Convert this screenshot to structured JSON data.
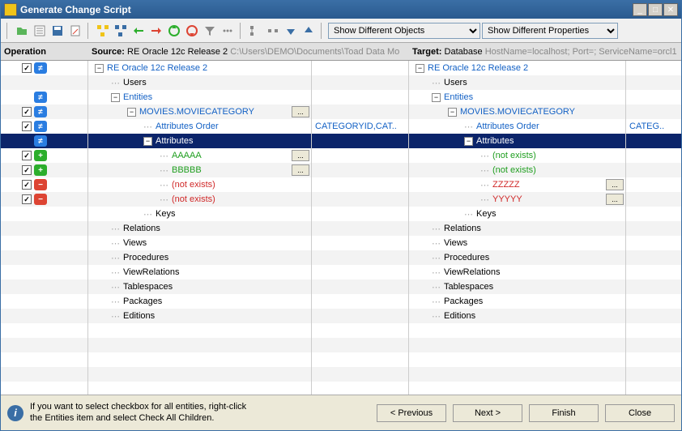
{
  "window": {
    "title": "Generate Change Script"
  },
  "toolbar": {
    "combo1": "Show Different Objects",
    "combo2": "Show Different Properties"
  },
  "headers": {
    "operation": "Operation",
    "source_label": "Source:",
    "source_model": "RE Oracle 12c Release 2",
    "source_path": "C:\\Users\\DEMO\\Documents\\Toad Data Mo",
    "target_label": "Target:",
    "target_model": "Database",
    "target_path": "HostName=localhost; Port=; ServiceName=orcl1"
  },
  "rows": [
    {
      "op": {
        "cb": true,
        "badge": "diff",
        "sym": "≠"
      },
      "src": {
        "indent": 0,
        "exp": "-",
        "text": "RE Oracle 12c Release 2",
        "cls": "blue"
      },
      "tgt": {
        "indent": 0,
        "exp": "-",
        "text": "RE Oracle 12c Release 2",
        "cls": "blue"
      }
    },
    {
      "op": {},
      "src": {
        "indent": 1,
        "bul": true,
        "text": "Users"
      },
      "tgt": {
        "indent": 1,
        "bul": true,
        "text": "Users"
      }
    },
    {
      "op": {
        "badge": "diff",
        "sym": "≠"
      },
      "src": {
        "indent": 1,
        "exp": "-",
        "text": "Entities",
        "cls": "blue"
      },
      "tgt": {
        "indent": 1,
        "exp": "-",
        "text": "Entities",
        "cls": "blue"
      }
    },
    {
      "op": {
        "cb": true,
        "badge": "diff",
        "sym": "≠"
      },
      "src": {
        "indent": 2,
        "exp": "-",
        "text": "MOVIES.MOVIECATEGORY",
        "cls": "blue",
        "more": true
      },
      "tgt": {
        "indent": 2,
        "exp": "-",
        "text": "MOVIES.MOVIECATEGORY",
        "cls": "blue"
      }
    },
    {
      "op": {
        "cb": true,
        "badge": "diff",
        "sym": "≠"
      },
      "src": {
        "indent": 3,
        "bul": true,
        "text": "Attributes Order",
        "cls": "blue"
      },
      "srcdet": "CATEGORYID,CAT..",
      "tgt": {
        "indent": 3,
        "bul": true,
        "text": "Attributes Order",
        "cls": "blue"
      },
      "tgtdet": "CATEG.."
    },
    {
      "sel": true,
      "op": {
        "badge": "diff",
        "sym": "≠"
      },
      "src": {
        "indent": 3,
        "exp": "-",
        "text": "Attributes"
      },
      "tgt": {
        "indent": 3,
        "exp": "-",
        "text": "Attributes"
      }
    },
    {
      "op": {
        "cb": true,
        "badge": "plus",
        "sym": "+"
      },
      "src": {
        "indent": 4,
        "bul": true,
        "text": "AAAAA",
        "cls": "green",
        "more": true
      },
      "tgt": {
        "indent": 4,
        "bul": true,
        "text": "(not exists)",
        "cls": "green"
      }
    },
    {
      "op": {
        "cb": true,
        "badge": "plus",
        "sym": "+"
      },
      "src": {
        "indent": 4,
        "bul": true,
        "text": "BBBBB",
        "cls": "green",
        "more": true
      },
      "tgt": {
        "indent": 4,
        "bul": true,
        "text": "(not exists)",
        "cls": "green"
      }
    },
    {
      "op": {
        "cb": true,
        "badge": "minus",
        "sym": "−"
      },
      "src": {
        "indent": 4,
        "bul": true,
        "text": "(not exists)",
        "cls": "red"
      },
      "tgt": {
        "indent": 4,
        "bul": true,
        "text": "ZZZZZ",
        "cls": "red",
        "more": true
      }
    },
    {
      "op": {
        "cb": true,
        "badge": "minus",
        "sym": "−"
      },
      "src": {
        "indent": 4,
        "bul": true,
        "text": "(not exists)",
        "cls": "red"
      },
      "tgt": {
        "indent": 4,
        "bul": true,
        "text": "YYYYY",
        "cls": "red",
        "more": true
      }
    },
    {
      "op": {},
      "src": {
        "indent": 3,
        "bul": true,
        "text": "Keys"
      },
      "tgt": {
        "indent": 3,
        "bul": true,
        "text": "Keys"
      }
    },
    {
      "op": {},
      "src": {
        "indent": 1,
        "bul": true,
        "text": "Relations"
      },
      "tgt": {
        "indent": 1,
        "bul": true,
        "text": "Relations"
      }
    },
    {
      "op": {},
      "src": {
        "indent": 1,
        "bul": true,
        "text": "Views"
      },
      "tgt": {
        "indent": 1,
        "bul": true,
        "text": "Views"
      }
    },
    {
      "op": {},
      "src": {
        "indent": 1,
        "bul": true,
        "text": "Procedures"
      },
      "tgt": {
        "indent": 1,
        "bul": true,
        "text": "Procedures"
      }
    },
    {
      "op": {},
      "src": {
        "indent": 1,
        "bul": true,
        "text": "ViewRelations"
      },
      "tgt": {
        "indent": 1,
        "bul": true,
        "text": "ViewRelations"
      }
    },
    {
      "op": {},
      "src": {
        "indent": 1,
        "bul": true,
        "text": "Tablespaces"
      },
      "tgt": {
        "indent": 1,
        "bul": true,
        "text": "Tablespaces"
      }
    },
    {
      "op": {},
      "src": {
        "indent": 1,
        "bul": true,
        "text": "Packages"
      },
      "tgt": {
        "indent": 1,
        "bul": true,
        "text": "Packages"
      }
    },
    {
      "op": {},
      "src": {
        "indent": 1,
        "bul": true,
        "text": "Editions"
      },
      "tgt": {
        "indent": 1,
        "bul": true,
        "text": "Editions"
      }
    },
    {
      "op": {}
    },
    {
      "op": {}
    },
    {
      "op": {}
    },
    {
      "op": {}
    }
  ],
  "footer": {
    "hint_l1": "If you want to select checkbox for all entities, right-click",
    "hint_l2": "the Entities item and select Check All Children.",
    "prev": "< Previous",
    "next": "Next >",
    "finish": "Finish",
    "close": "Close"
  }
}
